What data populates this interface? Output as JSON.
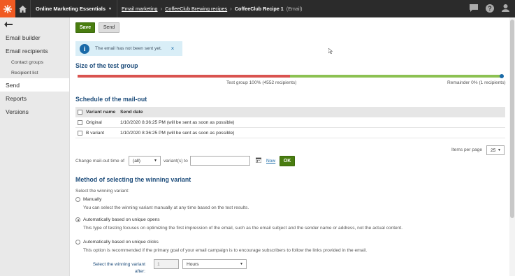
{
  "topbar": {
    "site_name": "Online Marketing Essentials",
    "breadcrumbs": [
      "Email marketing",
      "CoffeeClub Brewing recipes"
    ],
    "current": "CoffeeClub Recipe 1",
    "current_type": "(Email)"
  },
  "sidebar": {
    "items": [
      {
        "label": "Email builder"
      },
      {
        "label": "Email recipients"
      },
      {
        "label": "Contact groups"
      },
      {
        "label": "Recipient list"
      },
      {
        "label": "Send"
      },
      {
        "label": "Reports"
      },
      {
        "label": "Versions"
      }
    ]
  },
  "toolbar": {
    "save_label": "Save",
    "send_label": "Send"
  },
  "alert": {
    "text": "The email has not been sent yet.",
    "close": "×"
  },
  "test_group": {
    "heading": "Size of the test group",
    "left_label": "Test group 100% (4552 recipients)",
    "right_label": "Remainder 0% (1 recipients)",
    "test_fraction": 0.5
  },
  "schedule": {
    "heading": "Schedule of the mail-out",
    "columns": [
      "Variant name",
      "Send date"
    ],
    "rows": [
      {
        "name": "Original",
        "date": "1/10/2020 8:36:25 PM (will be sent as soon as possible)"
      },
      {
        "name": "B variant",
        "date": "1/10/2020 8:36:25 PM (will be sent as soon as possible)"
      }
    ],
    "items_per_page_label": "Items per page",
    "items_per_page": "25",
    "change_label": "Change mail-out time of",
    "variant_select": "(all)",
    "variants_to": "variant(s) to",
    "date_value": "",
    "now_label": "Now",
    "ok_label": "OK"
  },
  "method": {
    "heading": "Method of selecting the winning variant",
    "select_label": "Select the winning variant:",
    "options": [
      {
        "label": "Manually",
        "desc": "You can select the winning variant manually at any time based on the test results."
      },
      {
        "label": "Automatically based on unique opens",
        "desc": "This type of testing focuses on optimizing the first impression of the email, such as the email subject and the sender name or address, not the actual content."
      },
      {
        "label": "Automatically based on unique clicks",
        "desc": "This option is recommended if the primary goal of your email campaign is to encourage subscribers to follow the links provided in the email."
      }
    ],
    "after_label_1": "Select the winning variant",
    "after_label_2": "after:",
    "after_value": "1",
    "after_unit": "Hours"
  }
}
